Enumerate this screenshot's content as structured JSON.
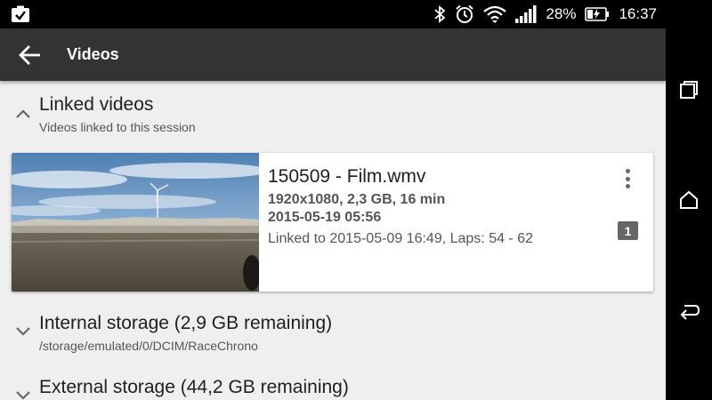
{
  "status_bar": {
    "left_icon": "clipboard-check-icon",
    "right_icons": [
      "bluetooth-icon",
      "alarm-clock-icon",
      "wifi-icon",
      "signal-icon"
    ],
    "battery_percent": "28%",
    "battery_icon": "battery-charging-icon",
    "time": "16:37"
  },
  "app_bar": {
    "back_icon": "arrow-back-icon",
    "title": "Videos"
  },
  "sections": {
    "linked": {
      "title": "Linked videos",
      "subtitle": "Videos linked to this session",
      "expanded": true
    },
    "internal": {
      "title": "Internal storage (2,9 GB remaining)",
      "subtitle": "/storage/emulated/0/DCIM/RaceChrono",
      "expanded": false
    },
    "external": {
      "title": "External storage (44,2 GB remaining)",
      "expanded": false
    }
  },
  "video": {
    "name": "150509 - Film.wmv",
    "meta": "1920x1080, 2,3 GB, 16 min",
    "date": "2015-05-19 05:56",
    "link_info": "Linked to 2015-05-09 16:49, Laps: 54 - 62",
    "badge": "1",
    "menu_icon": "more-vert-icon"
  },
  "nav_bar": {
    "items": [
      "recent-apps-icon",
      "home-icon",
      "back-icon"
    ]
  },
  "colors": {
    "app_bar": "#333333",
    "background": "#efefef",
    "badge": "#666666"
  }
}
